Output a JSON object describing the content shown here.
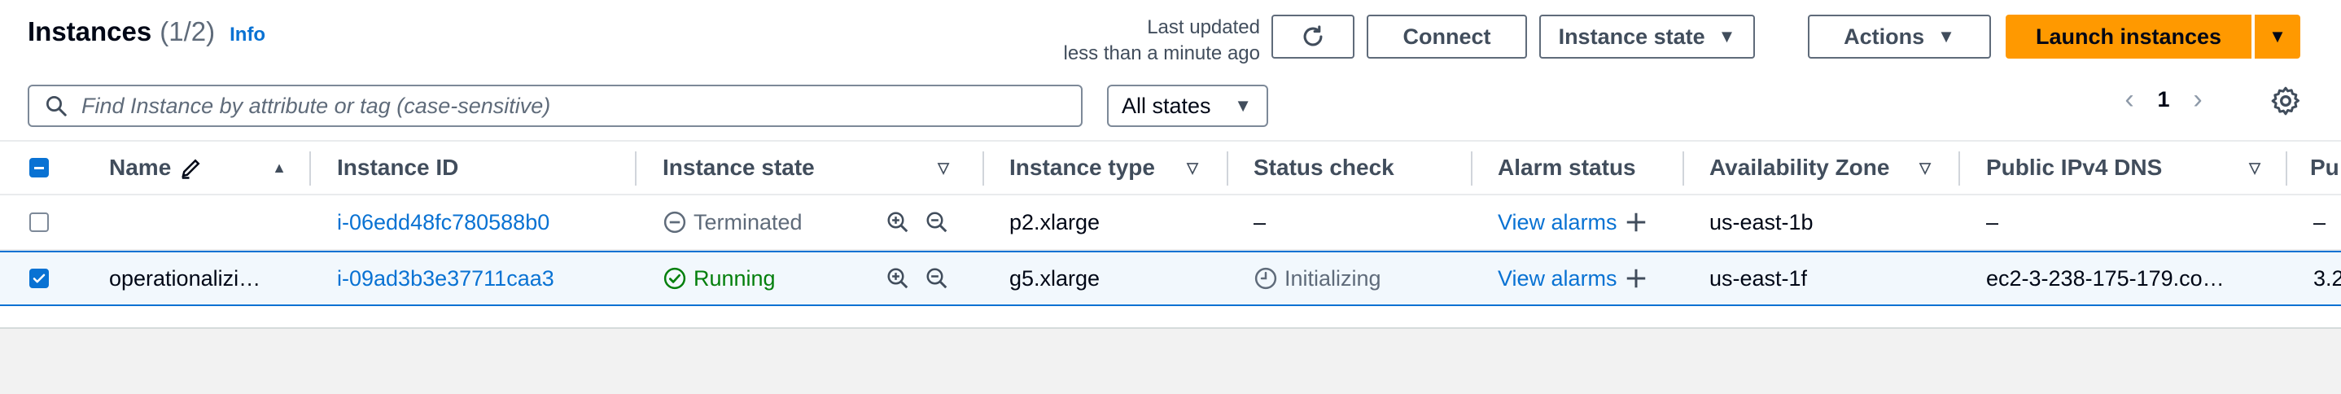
{
  "header": {
    "title": "Instances",
    "count": "(1/2)",
    "info_link": "Info",
    "last_updated_line1": "Last updated",
    "last_updated_line2": "less than a minute ago",
    "connect_label": "Connect",
    "instance_state_label": "Instance state",
    "actions_label": "Actions",
    "launch_label": "Launch instances"
  },
  "filter": {
    "search_placeholder": "Find Instance by attribute or tag (case-sensitive)",
    "state_select": "All states"
  },
  "pagination": {
    "current_page": "1"
  },
  "columns": {
    "name": "Name",
    "instance_id": "Instance ID",
    "instance_state": "Instance state",
    "instance_type": "Instance type",
    "status_check": "Status check",
    "alarm_status": "Alarm status",
    "availability_zone": "Availability Zone",
    "public_dns": "Public IPv4 DNS",
    "public_ip": "Pu"
  },
  "rows": [
    {
      "selected": false,
      "name": "",
      "instance_id": "i-06edd48fc780588b0",
      "state": "Terminated",
      "type": "p2.xlarge",
      "status_check": "–",
      "alarm": "View alarms",
      "zone": "us-east-1b",
      "dns": "–",
      "ip": "–"
    },
    {
      "selected": true,
      "name": "operationalizi…",
      "instance_id": "i-09ad3b3e37711caa3",
      "state": "Running",
      "type": "g5.xlarge",
      "status_check": "Initializing",
      "alarm": "View alarms",
      "zone": "us-east-1f",
      "dns": "ec2-3-238-175-179.co…",
      "ip": "3.2"
    }
  ],
  "colors": {
    "accent": "#0972d3",
    "launch": "#ff9900",
    "running": "#037f0c",
    "muted": "#5f6b7a"
  }
}
